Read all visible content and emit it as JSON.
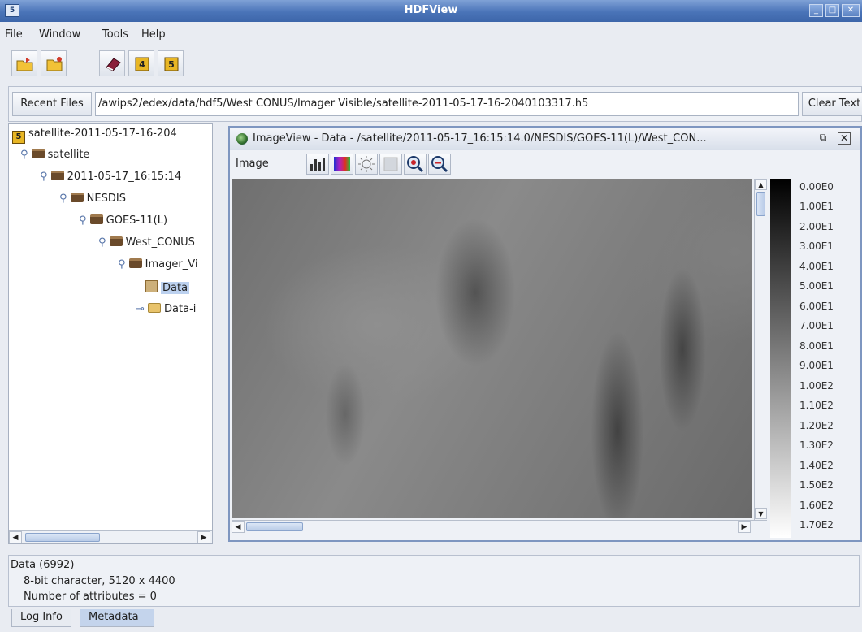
{
  "window": {
    "title": "HDFView",
    "icon": "hdfview-icon"
  },
  "menubar": [
    "File",
    "Window",
    "Tools",
    "Help"
  ],
  "toolbar": [
    "open-file-icon",
    "new-file-icon",
    "users-guide-icon",
    "hdf4-library-icon",
    "hdf5-library-icon"
  ],
  "recent": {
    "button_label": "Recent Files",
    "path": "/awips2/edex/data/hdf5/West CONUS/Imager Visible/satellite-2011-05-17-16-2040103317.h5",
    "clear_label": "Clear Text"
  },
  "tree": [
    {
      "label": "satellite-2011-05-17-16-204",
      "kind": "h5-file"
    },
    {
      "label": "satellite",
      "kind": "folder"
    },
    {
      "label": "2011-05-17_16:15:14",
      "kind": "folder"
    },
    {
      "label": "NESDIS",
      "kind": "folder"
    },
    {
      "label": "GOES-11(L)",
      "kind": "folder"
    },
    {
      "label": "West_CONUS",
      "kind": "folder"
    },
    {
      "label": "Imager_Vi",
      "kind": "folder"
    },
    {
      "label": "Data",
      "kind": "dataset",
      "selected": true
    },
    {
      "label": "Data-i",
      "kind": "folder-open"
    }
  ],
  "image_view": {
    "title": "ImageView  -  Data  -  /satellite/2011-05-17_16:15:14.0/NESDIS/GOES-11(L)/West_CON...",
    "menu_label": "Image",
    "tools": [
      "histogram-icon",
      "palette-icon",
      "brightness-icon",
      "contour-icon",
      "zoom-in-icon",
      "zoom-out-icon"
    ],
    "palette_values": [
      "0.00E0",
      "1.00E1",
      "2.00E1",
      "3.00E1",
      "4.00E1",
      "5.00E1",
      "6.00E1",
      "7.00E1",
      "8.00E1",
      "9.00E1",
      "1.00E2",
      "1.10E2",
      "1.20E2",
      "1.30E2",
      "1.40E2",
      "1.50E2",
      "1.60E2",
      "1.70E2"
    ]
  },
  "status": {
    "line1": "Data (6992)",
    "line2": "8-bit character,    5120 x 4400",
    "line3": "Number of attributes = 0"
  },
  "tabs": [
    "Log Info",
    "Metadata"
  ]
}
